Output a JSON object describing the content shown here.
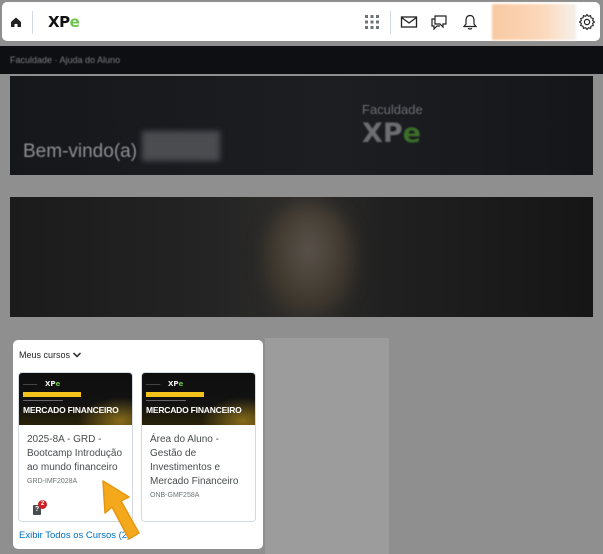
{
  "topbar": {
    "logo_text": "XP",
    "logo_e": "e"
  },
  "breadcrumb": {
    "text": "Faculdade · Ajuda do Aluno"
  },
  "banner": {
    "welcome": "Bem-vindo(a)",
    "faculty_label": "Faculdade",
    "faculty_logo": "XP",
    "faculty_logo_e": "e"
  },
  "my_courses": {
    "title": "Meus cursos",
    "view_all_link": "Exibir Todos os Cursos (2)",
    "courses": [
      {
        "image_logo": "XP",
        "image_logo_e": "e",
        "image_headline": "MERCADO FINANCEIRO",
        "name": "2025-8A - GRD - Bootcamp Introdução ao mundo financeiro",
        "code": "GRD-IMF2028A",
        "alert_count": "2",
        "alert_glyph": "?"
      },
      {
        "image_logo": "XP",
        "image_logo_e": "e",
        "image_headline": "MERCADO FINANCEIRO",
        "name": "Área do Aluno - Gestão de Investimentos e Mercado Financeiro",
        "code": "ONB-GMF258A"
      }
    ]
  },
  "icons": {
    "home": "home-icon",
    "apps": "grid-icon",
    "mail": "mail-icon",
    "chat": "chat-icon",
    "notifications": "bell-icon",
    "settings": "gear-icon",
    "expand": "chevron-down-icon",
    "pointer": "pointer-arrow-icon"
  },
  "colors": {
    "link": "#006fbf",
    "brand_green": "#6cc24a",
    "accent_yellow": "#f3c21b",
    "alert_red": "#cd2026",
    "arrow_orange": "#f4a81c"
  }
}
